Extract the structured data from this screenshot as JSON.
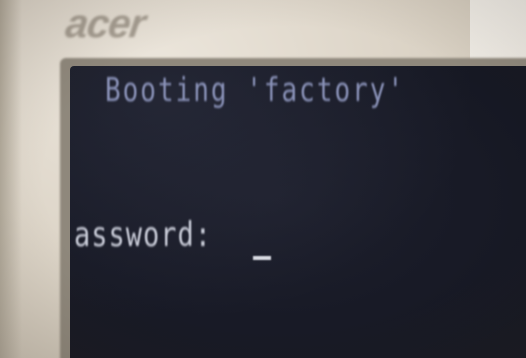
{
  "monitor": {
    "brand_logo": "acer"
  },
  "terminal": {
    "lines": [
      "Booting 'factory'",
      "assword:"
    ],
    "cursor": "_"
  }
}
